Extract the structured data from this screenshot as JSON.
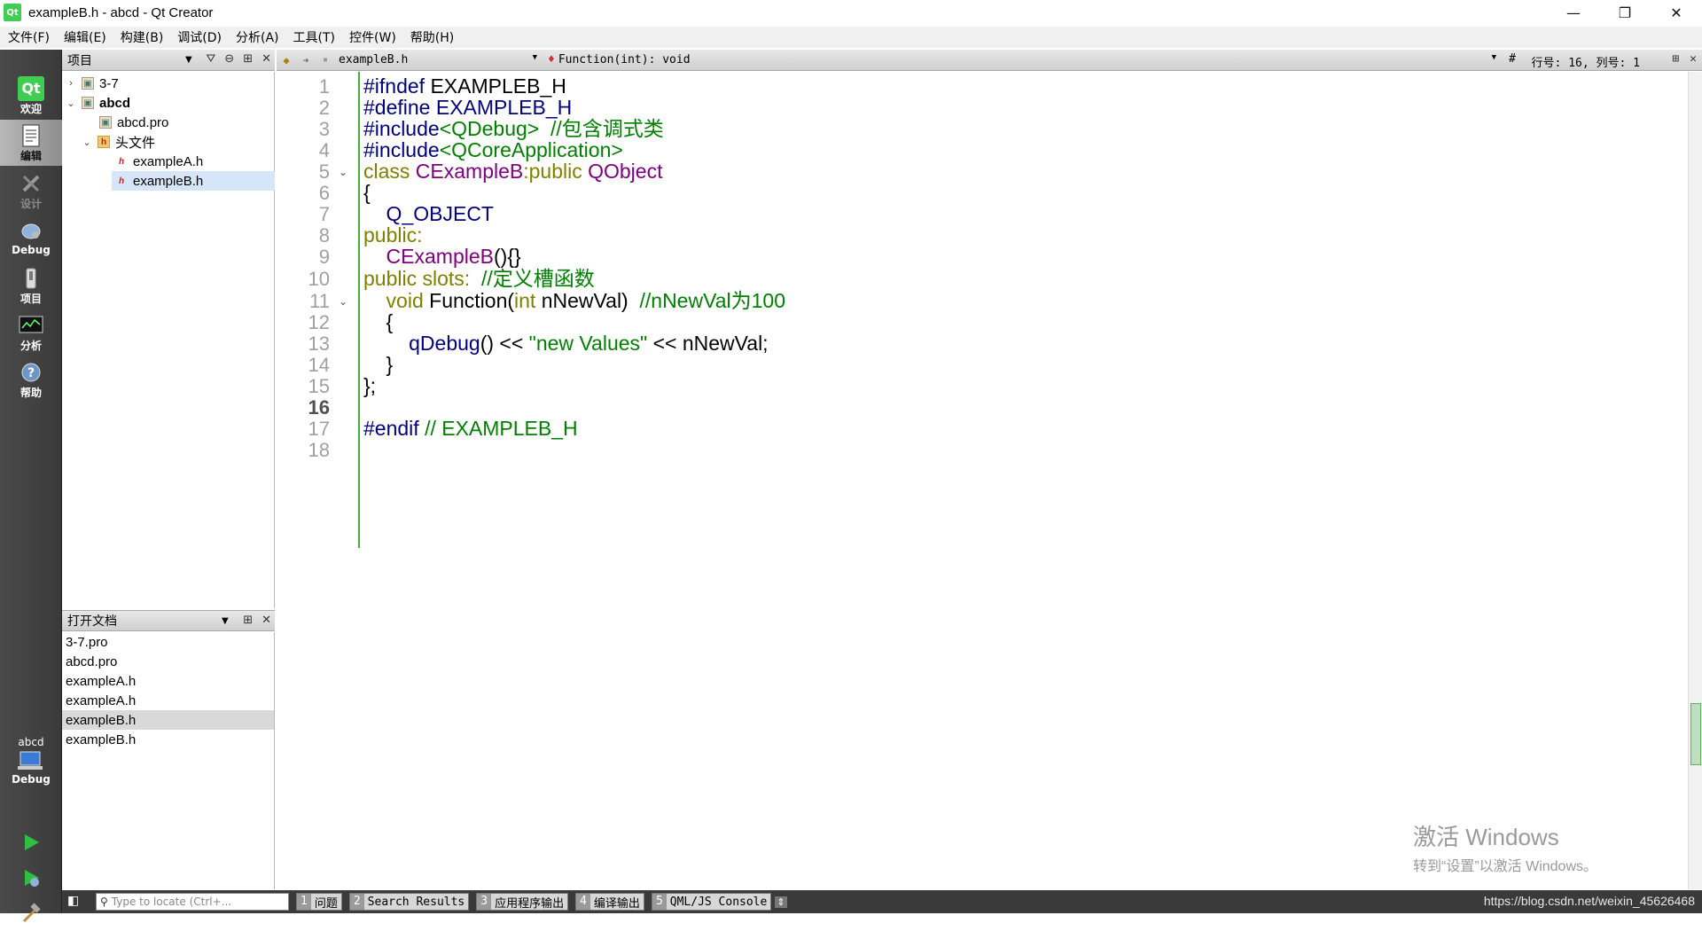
{
  "window": {
    "title": "exampleB.h - abcd - Qt Creator",
    "minimize": "—",
    "restore": "❐",
    "close": "✕"
  },
  "menu": [
    "文件(F)",
    "编辑(E)",
    "构建(B)",
    "调试(D)",
    "分析(A)",
    "工具(T)",
    "控件(W)",
    "帮助(H)"
  ],
  "modes": {
    "welcome": "欢迎",
    "edit": "编辑",
    "design": "设计",
    "debug": "Debug",
    "project": "项目",
    "analyze": "分析",
    "help": "帮助",
    "kit_project": "abcd",
    "kit_config": "Debug"
  },
  "project_panel": {
    "title": "项目",
    "tree": [
      {
        "label": "3-7",
        "expanded": false,
        "type": "pro"
      },
      {
        "label": "abcd",
        "expanded": true,
        "type": "pro",
        "bold": true
      },
      {
        "label": "abcd.pro",
        "type": "pro"
      },
      {
        "label": "头文件",
        "expanded": true,
        "type": "folder"
      },
      {
        "label": "exampleA.h",
        "type": "header"
      },
      {
        "label": "exampleB.h",
        "type": "header",
        "selected": true
      }
    ]
  },
  "open_docs": {
    "title": "打开文档",
    "items": [
      "3-7.pro",
      "abcd.pro",
      "exampleA.h",
      "exampleA.h",
      "exampleB.h",
      "exampleB.h"
    ],
    "selected_index": 4
  },
  "editor_toolbar": {
    "file": "exampleB.h",
    "function": "Function(int): void",
    "hash": "#",
    "cursor": "行号: 16, 列号: 1"
  },
  "code": {
    "current_line": 16,
    "line_numbers": [
      "1",
      "2",
      "3",
      "4",
      "5",
      "6",
      "7",
      "8",
      "9",
      "10",
      "11",
      "12",
      "13",
      "14",
      "15",
      "16",
      "17",
      "18"
    ],
    "lines": [
      {
        "a": "#ifndef ",
        "b": "EXAMPLEB_H"
      },
      {
        "a": "#define ",
        "b": "EXAMPLEB_H"
      },
      {
        "a": "#include",
        "b": "<QDebug>",
        "c": "  //包含调式类"
      },
      {
        "a": "#include",
        "b": "<QCoreApplication>"
      },
      {
        "a": "class ",
        "b": "CExampleB",
        "c": ":public ",
        "d": "QObject"
      },
      {
        "a": "{"
      },
      {
        "a": "    Q_OBJECT"
      },
      {
        "a": "public",
        "b": ":"
      },
      {
        "a": "    CExampleB",
        "b": "(){}"
      },
      {
        "a": "public slots",
        "b": ":  ",
        "c": "//定义槽函数"
      },
      {
        "a": "    void ",
        "b": "Function(",
        "c": "int",
        "d": " nNewVal)  ",
        "e": "//nNewVal为100"
      },
      {
        "a": "    {"
      },
      {
        "a": "        qDebug",
        "b": "() << ",
        "c": "\"new Values\"",
        "d": " << nNewVal;"
      },
      {
        "a": "    }"
      },
      {
        "a": "};"
      },
      {
        "a": ""
      },
      {
        "a": "#endif ",
        "b": "// EXAMPLEB_H"
      },
      {
        "a": ""
      }
    ]
  },
  "statusbar": {
    "locator_placeholder": "Type to locate (Ctrl+...",
    "tabs": [
      {
        "num": "1",
        "label": "问题"
      },
      {
        "num": "2",
        "label": "Search Results"
      },
      {
        "num": "3",
        "label": "应用程序输出"
      },
      {
        "num": "4",
        "label": "编译输出"
      },
      {
        "num": "5",
        "label": "QML/JS Console"
      }
    ],
    "csdn": "https://blog.csdn.net/weixin_45626468"
  },
  "watermark": {
    "line1": "激活 Windows",
    "line2": "转到“设置”以激活 Windows。"
  }
}
